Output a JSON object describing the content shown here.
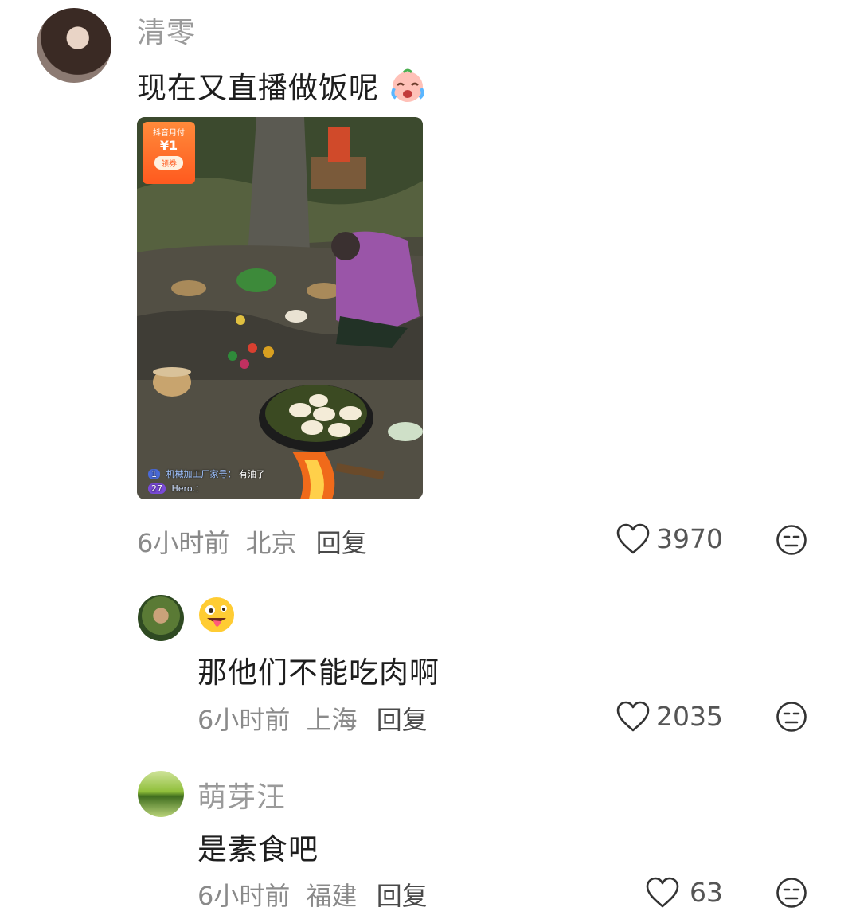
{
  "comments": [
    {
      "username": "清零",
      "text": "现在又直播做饭呢",
      "text_emoji": "crying-face-emoji",
      "image": {
        "coupon_title": "抖音月付",
        "coupon_amount": "¥1",
        "coupon_button": "领券",
        "overlay_comment_badge": "1",
        "overlay_comment_user": "机械加工厂家号：",
        "overlay_comment_text": "有油了",
        "overlay_comment2_badge": "27",
        "overlay_comment2_user": "Hero.："
      },
      "time": "6小时前",
      "location": "北京",
      "reply_label": "回复",
      "likes": "3970"
    },
    {
      "username_emoji": "zany-face-emoji",
      "text": "那他们不能吃肉啊",
      "time": "6小时前",
      "location": "上海",
      "reply_label": "回复",
      "likes": "2035"
    },
    {
      "username": "萌芽汪",
      "text": "是素食吧",
      "time": "6小时前",
      "location": "福建",
      "reply_label": "回复",
      "likes": "63"
    }
  ],
  "icons": {
    "like": "heart-outline-icon",
    "dislike": "unamused-face-icon"
  }
}
